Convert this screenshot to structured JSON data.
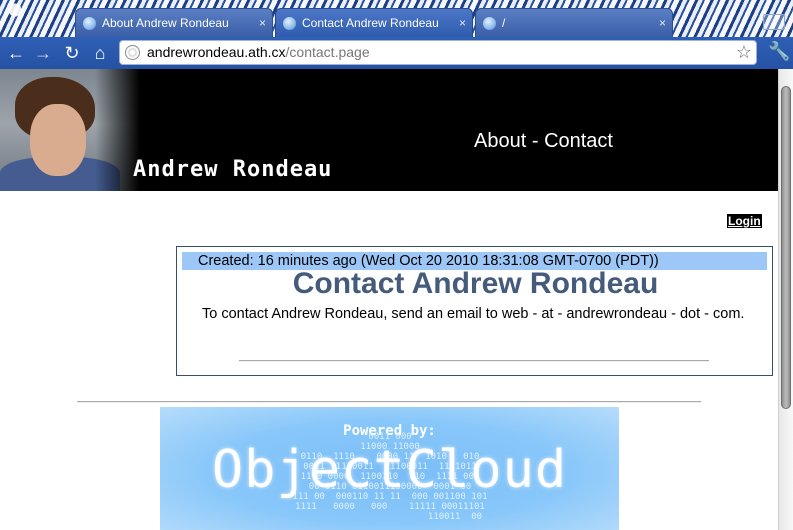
{
  "browser": {
    "tabs": [
      {
        "title": "About Andrew Rondeau",
        "active": false
      },
      {
        "title": "Contact Andrew Rondeau",
        "active": true
      },
      {
        "title": "/",
        "active": false
      }
    ],
    "close_glyph": "×",
    "address": {
      "host": "andrewrondeau.ath.cx",
      "path": "/contact.page"
    },
    "icons": [
      "back-icon",
      "forward-icon",
      "reload-icon",
      "home-icon",
      "globe-icon",
      "star-icon",
      "wrench-icon"
    ]
  },
  "header": {
    "site_name": "Andrew Rondeau",
    "nav": {
      "about": "About",
      "separator": "-",
      "contact": "Contact"
    }
  },
  "login_label": "Login",
  "content": {
    "created": "Created: 16 minutes ago (Wed Oct 20 2010 18:31:08 GMT-0700 (PDT))",
    "title": "Contact Andrew Rondeau",
    "body": "To contact Andrew Rondeau, send an email to web - at - andrewrondeau - dot - com."
  },
  "footer": {
    "powered_by": "Powered by:",
    "logo_text": "ObjectCloud"
  },
  "colors": {
    "header_bg": "#000000",
    "created_bar": "#9cc7f7",
    "title_color": "#445b7c",
    "banner_blue": "#79bdf7"
  }
}
